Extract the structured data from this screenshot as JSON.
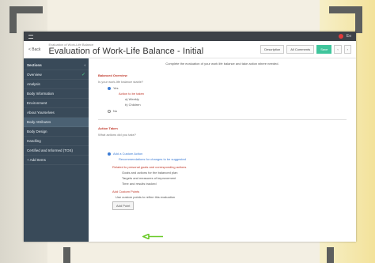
{
  "topbar": {
    "user": "Eo"
  },
  "header": {
    "back": "< Back",
    "breadcrumb": "Evaluation of Work-Life Balance",
    "title": "Evaluation of Work-Life Balance - Initial",
    "btn_description": "Description",
    "btn_comments": "All Comments",
    "btn_save": "Save"
  },
  "sidebar": {
    "items": [
      {
        "label": "Sections",
        "active": false,
        "header": true
      },
      {
        "label": "Overview",
        "active": false,
        "done": true
      },
      {
        "label": "Analysis",
        "active": false
      },
      {
        "label": "Body Information",
        "active": false
      },
      {
        "label": "Environment",
        "active": false
      },
      {
        "label": "About Yourselves",
        "active": false
      },
      {
        "label": "Body Attributes",
        "active": true
      },
      {
        "label": "Body Design",
        "active": false
      },
      {
        "label": "Handling",
        "active": false
      },
      {
        "label": "Certified and Informed (TOS)",
        "active": false
      },
      {
        "label": "+ Add Items",
        "active": false
      }
    ]
  },
  "content": {
    "intro": "Complete the evaluation of your work life balance and take action where needed.",
    "section1": "Balanced Overview",
    "field1": "Is your work-life balance stable?",
    "opt_yes": "Yes",
    "sub_a": "Action to be taken",
    "sub_b": "a) Weekly",
    "sub_c": "b) Children",
    "opt_no": "No",
    "section2": "Action Taken",
    "field2": "What actions did you take?",
    "opt_other": "Add a Custom Action",
    "other_note": "Recommendations for changes to be suggested",
    "section3": "Related to personal goals and corresponding actions",
    "bullet1": "Goals and actions for the balanced plan",
    "bullet2": "Targets and measures of improvement",
    "bullet3": "Time and results tracked",
    "section4": "Add Custom Points",
    "field4": "Use custom points to refine this evaluation",
    "add_btn": "Add Point"
  }
}
